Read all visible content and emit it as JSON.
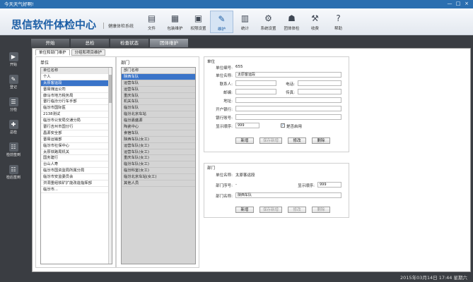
{
  "window": {
    "greeting": "今天天气好啊!",
    "min": "—",
    "max": "□",
    "close": "×"
  },
  "header": {
    "logo": "思信软件体检中心",
    "sub": "健康体检系统"
  },
  "toolbar": [
    {
      "label": "文件",
      "icon": "file-icon",
      "glyph": "▤"
    },
    {
      "label": "包装维护",
      "icon": "package-icon",
      "glyph": "▦"
    },
    {
      "label": "权限设置",
      "icon": "permission-icon",
      "glyph": "▣"
    },
    {
      "label": "维护",
      "icon": "maintenance-icon",
      "glyph": "✎"
    },
    {
      "label": "统计",
      "icon": "stats-icon",
      "glyph": "▥"
    },
    {
      "label": "系统设置",
      "icon": "settings-icon",
      "glyph": "⚙"
    },
    {
      "label": "团体体检",
      "icon": "group-icon",
      "glyph": "☗"
    },
    {
      "label": "收费",
      "icon": "charge-icon",
      "glyph": "⚒"
    },
    {
      "label": "帮助",
      "icon": "help-icon",
      "glyph": "?"
    }
  ],
  "sidebar": [
    {
      "label": "开始",
      "icon": "start-icon"
    },
    {
      "label": "登记",
      "icon": "register-icon"
    },
    {
      "label": "分检",
      "icon": "sort-icon"
    },
    {
      "label": "总检",
      "icon": "summary-icon"
    },
    {
      "label": "检前签到",
      "icon": "checkin-icon"
    },
    {
      "label": "检后签到",
      "icon": "checkout-icon"
    }
  ],
  "tabs": [
    "开始",
    "总检",
    "检查状态",
    "团体维护"
  ],
  "subtabs": [
    "单位和部门维护",
    "分组和项目维护"
  ],
  "units": {
    "title": "单位",
    "header": "单位名称",
    "rows": [
      "个人",
      "太原客运段",
      "晋易煤运公司",
      "康马市地方税务局",
      "晋行临汾分行车手部",
      "临汾市国际医",
      "2138测试",
      "临汾市公安局交通分局",
      "晋行吉州市国分行",
      "昌源安全部",
      "晋易运输部",
      "临汾市社保中心",
      "太原铁路局机关",
      "国务建行",
      "台山人寿",
      "临汾市国资监局所属分局",
      "临汾市安监委员会",
      "洪洞重组铁矿扩能改造指挥部",
      "临汾市..."
    ]
  },
  "depts": {
    "title": "部门",
    "header": "部门名称",
    "rows": [
      "陕西车队",
      "运营车队",
      "运营车队",
      "重庆车队",
      "机关车队",
      "临汾车队",
      "临汾北京车站",
      "临汾嘉盛源",
      "陶瓷中心",
      "食宿车队",
      "陕西车队(女工)",
      "运营车队(女工)",
      "运营车队(女工)",
      "重庆车队(女工)",
      "临汾车队(女工)",
      "临汾科室(女工)",
      "临汾北京车站(女工)",
      "其他人员"
    ]
  },
  "unit_form": {
    "title": "单位",
    "code_label": "单位编号:",
    "code_value": "655",
    "name_label": "单位名称:",
    "name_value": "太原客运段",
    "contact_label": "联系人:",
    "contact_value": "",
    "phone_label": "电话:",
    "phone_value": "",
    "email_label": "邮编:",
    "email_value": "",
    "fax_label": "传真:",
    "fax_value": "",
    "address_label": "地址:",
    "address_value": "",
    "bank_label": "开户银行:",
    "bank_value": "",
    "account_label": "银行账号:",
    "account_value": "",
    "order_label": "显示顺序:",
    "order_value": "999",
    "enabled_label": "是否启用",
    "enabled_mark": "✓",
    "buttons": [
      "新增",
      "保存新增",
      "修改",
      "删除"
    ]
  },
  "dept_form": {
    "title": "部门",
    "unit_label": "单位名称:",
    "unit_value": "太原客运段",
    "deptno_label": "部门序号:",
    "deptno_value": "-",
    "order_label": "显示顺序:",
    "order_value": "999",
    "deptname_label": "部门名称:",
    "deptname_value": "陕西车队",
    "buttons": [
      "新增",
      "保存新增",
      "修改",
      "删除"
    ]
  },
  "footer": {
    "datetime": "2015年03月14日 17:44 星期六"
  }
}
